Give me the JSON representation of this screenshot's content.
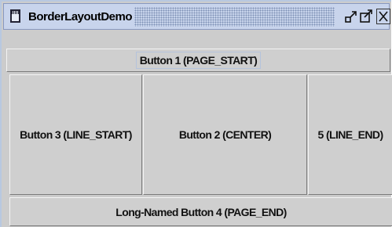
{
  "window": {
    "title": "BorderLayoutDemo",
    "controls": {
      "iconify": "iconify-icon",
      "maximize": "maximize-icon",
      "close": "close-icon"
    }
  },
  "buttons": {
    "page_start": "Button 1 (PAGE_START)",
    "line_start": "Button 3 (LINE_START)",
    "center": "Button 2 (CENTER)",
    "line_end": "5 (LINE_END)",
    "page_end": "Long-Named Button 4 (PAGE_END)"
  },
  "colors": {
    "titlebar": "#c8d4ec",
    "panel": "#cccccc",
    "button_face": "#cfcfcf",
    "focus_ring": "#b4c3dc"
  }
}
